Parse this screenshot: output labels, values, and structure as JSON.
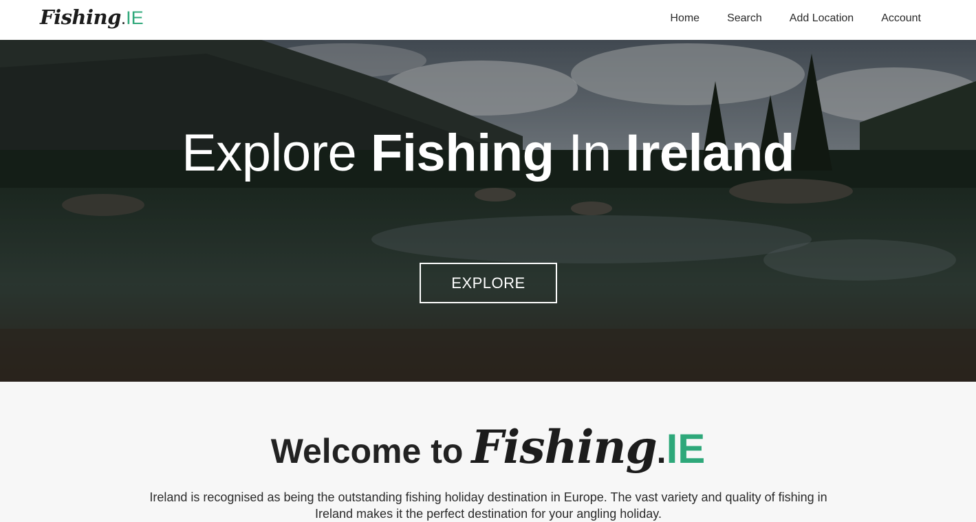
{
  "brand": {
    "name": "Fishing",
    "dot": ".",
    "tld": "IE",
    "accent_color": "#2ea87a"
  },
  "nav": {
    "items": [
      {
        "label": "Home"
      },
      {
        "label": "Search"
      },
      {
        "label": "Add Location"
      },
      {
        "label": "Account"
      }
    ]
  },
  "hero": {
    "title_part1": "Explore ",
    "title_part2": "Fishing",
    "title_part3": " In ",
    "title_part4": "Ireland",
    "button_label": "EXPLORE"
  },
  "welcome": {
    "prefix": "Welcome to",
    "brand": "Fishing",
    "dot": ".",
    "tld": "IE",
    "paragraph": "Ireland is recognised as being the outstanding fishing holiday destination in Europe. The vast variety and quality of fishing in Ireland makes it the perfect destination for your angling holiday."
  }
}
